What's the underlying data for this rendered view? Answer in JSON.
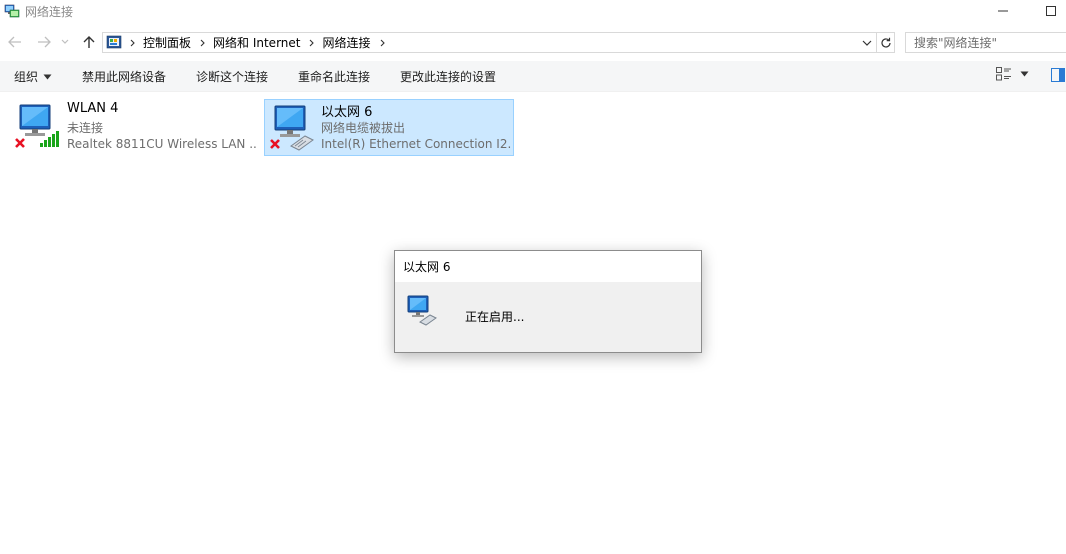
{
  "window": {
    "title": "网络连接",
    "icon": "network-connections-icon"
  },
  "address_bar": {
    "crumbs": [
      "控制面板",
      "网络和 Internet",
      "网络连接"
    ],
    "search_placeholder": "搜索\"网络连接\""
  },
  "toolbar": {
    "organize": "组织",
    "disable": "禁用此网络设备",
    "diagnose": "诊断这个连接",
    "rename": "重命名此连接",
    "settings": "更改此连接的设置"
  },
  "items": [
    {
      "name": "WLAN 4",
      "status": "未连接",
      "device": "Realtek 8811CU Wireless LAN ...",
      "selected": false
    },
    {
      "name": "以太网 6",
      "status": "网络电缆被拔出",
      "device": "Intel(R) Ethernet Connection I2...",
      "selected": true
    }
  ],
  "dialog": {
    "title": "以太网 6",
    "message": "正在启用..."
  },
  "colors": {
    "selection_bg": "#cce8ff",
    "selection_border": "#99d1ff",
    "error_red": "#e81123",
    "signal_green": "#1aa51a",
    "monitor_blue": "#2a7bd4"
  }
}
